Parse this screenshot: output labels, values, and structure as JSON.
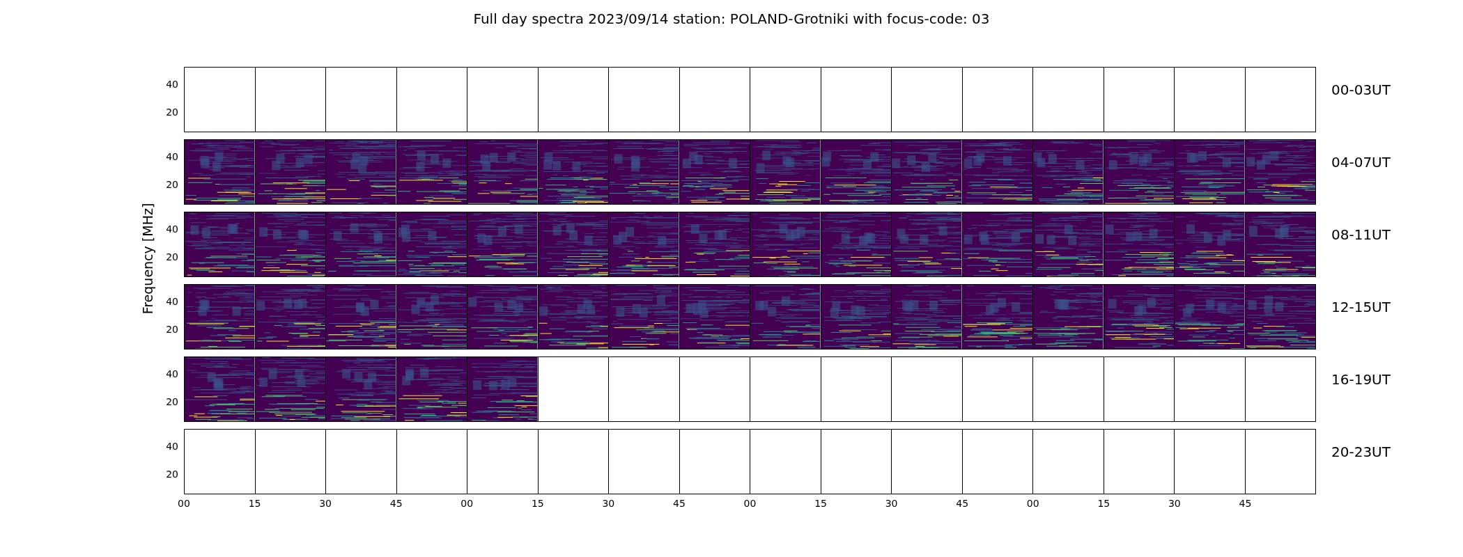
{
  "title": "Full day spectra 2023/09/14 station: POLAND-Grotniki with focus-code: 03",
  "ylabel": "Frequency [MHz]",
  "rows": [
    {
      "label": "00-03UT",
      "yticks": [
        "40",
        "20"
      ],
      "panels": [
        {
          "kind": "empty"
        },
        {
          "kind": "empty"
        },
        {
          "kind": "empty"
        },
        {
          "kind": "empty"
        },
        {
          "kind": "empty"
        },
        {
          "kind": "empty"
        },
        {
          "kind": "empty"
        },
        {
          "kind": "empty"
        },
        {
          "kind": "empty"
        },
        {
          "kind": "empty"
        },
        {
          "kind": "empty"
        },
        {
          "kind": "empty"
        },
        {
          "kind": "empty"
        },
        {
          "kind": "empty"
        },
        {
          "kind": "empty"
        },
        {
          "kind": "empty"
        }
      ]
    },
    {
      "label": "04-07UT",
      "yticks": [
        "40",
        "20"
      ],
      "panels": [
        {
          "kind": "spectrum"
        },
        {
          "kind": "spectrum"
        },
        {
          "kind": "spectrum"
        },
        {
          "kind": "spectrum"
        },
        {
          "kind": "spectrum"
        },
        {
          "kind": "spectrum"
        },
        {
          "kind": "spectrum"
        },
        {
          "kind": "spectrum"
        },
        {
          "kind": "spectrum"
        },
        {
          "kind": "spectrum"
        },
        {
          "kind": "spectrum"
        },
        {
          "kind": "spectrum"
        },
        {
          "kind": "spectrum"
        },
        {
          "kind": "spectrum"
        },
        {
          "kind": "spectrum"
        },
        {
          "kind": "spectrum"
        }
      ]
    },
    {
      "label": "08-11UT",
      "yticks": [
        "40",
        "20"
      ],
      "panels": [
        {
          "kind": "spectrum"
        },
        {
          "kind": "spectrum"
        },
        {
          "kind": "spectrum"
        },
        {
          "kind": "spectrum"
        },
        {
          "kind": "spectrum"
        },
        {
          "kind": "spectrum"
        },
        {
          "kind": "spectrum"
        },
        {
          "kind": "spectrum"
        },
        {
          "kind": "spectrum"
        },
        {
          "kind": "spectrum"
        },
        {
          "kind": "spectrum"
        },
        {
          "kind": "spectrum"
        },
        {
          "kind": "spectrum"
        },
        {
          "kind": "spectrum"
        },
        {
          "kind": "spectrum"
        },
        {
          "kind": "spectrum"
        }
      ]
    },
    {
      "label": "12-15UT",
      "yticks": [
        "40",
        "20"
      ],
      "panels": [
        {
          "kind": "spectrum"
        },
        {
          "kind": "spectrum"
        },
        {
          "kind": "spectrum"
        },
        {
          "kind": "spectrum"
        },
        {
          "kind": "spectrum"
        },
        {
          "kind": "spectrum"
        },
        {
          "kind": "spectrum"
        },
        {
          "kind": "spectrum"
        },
        {
          "kind": "spectrum"
        },
        {
          "kind": "spectrum"
        },
        {
          "kind": "spectrum"
        },
        {
          "kind": "spectrum"
        },
        {
          "kind": "spectrum"
        },
        {
          "kind": "spectrum"
        },
        {
          "kind": "spectrum"
        },
        {
          "kind": "spectrum"
        }
      ]
    },
    {
      "label": "16-19UT",
      "yticks": [
        "40",
        "20"
      ],
      "panels": [
        {
          "kind": "spectrum"
        },
        {
          "kind": "spectrum"
        },
        {
          "kind": "spectrum"
        },
        {
          "kind": "spectrum"
        },
        {
          "kind": "spectrum"
        },
        {
          "kind": "empty"
        },
        {
          "kind": "empty"
        },
        {
          "kind": "empty"
        },
        {
          "kind": "empty"
        },
        {
          "kind": "empty"
        },
        {
          "kind": "empty"
        },
        {
          "kind": "empty"
        },
        {
          "kind": "empty"
        },
        {
          "kind": "empty"
        },
        {
          "kind": "empty"
        },
        {
          "kind": "empty"
        }
      ]
    },
    {
      "label": "20-23UT",
      "yticks": [
        "40",
        "20"
      ],
      "panels": [
        {
          "kind": "empty"
        },
        {
          "kind": "empty"
        },
        {
          "kind": "empty"
        },
        {
          "kind": "empty"
        },
        {
          "kind": "empty"
        },
        {
          "kind": "empty"
        },
        {
          "kind": "empty"
        },
        {
          "kind": "empty"
        },
        {
          "kind": "empty"
        },
        {
          "kind": "empty"
        },
        {
          "kind": "empty"
        },
        {
          "kind": "empty"
        },
        {
          "kind": "empty"
        },
        {
          "kind": "empty"
        },
        {
          "kind": "empty"
        },
        {
          "kind": "empty"
        }
      ]
    }
  ],
  "xticks": [
    "00",
    "15",
    "30",
    "45",
    "00",
    "15",
    "30",
    "45",
    "00",
    "15",
    "30",
    "45",
    "00",
    "15",
    "30",
    "45"
  ]
}
